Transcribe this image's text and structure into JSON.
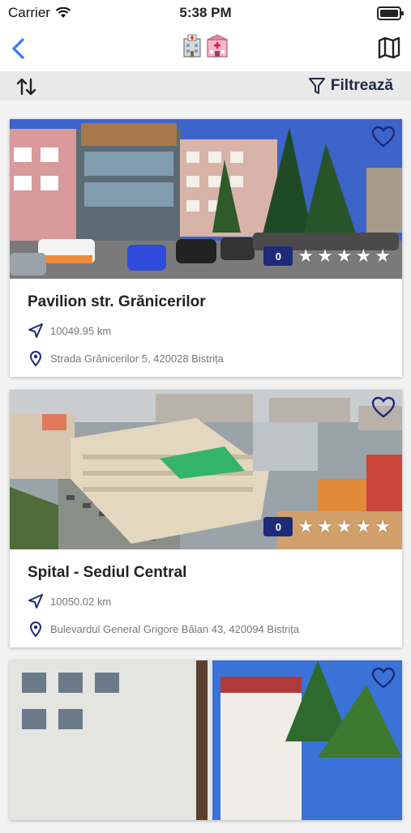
{
  "status": {
    "carrier": "Carrier",
    "time": "5:38 PM"
  },
  "toolbar": {
    "filter_label": "Filtrează"
  },
  "cards": [
    {
      "title": "Pavilion str. Grănicerilor",
      "distance": "10049.95 km",
      "address": "Strada Grănicerilor 5, 420028 Bistrița",
      "rating": "0"
    },
    {
      "title": "Spital - Sediul Central",
      "distance": "10050.02 km",
      "address": "Bulevardul General Grigore Bălan 43, 420094 Bistrița",
      "rating": "0"
    },
    {
      "title": "",
      "distance": "",
      "address": "",
      "rating": ""
    }
  ],
  "colors": {
    "accent": "#1e2a7a",
    "nav_blue": "#2f7cf6",
    "toolbar_bg": "#e9e9e9"
  },
  "icons": [
    "back-icon",
    "hospital-logo-icon",
    "map-icon",
    "sort-icon",
    "filter-icon",
    "heart-icon",
    "navigation-arrow-icon",
    "location-pin-icon",
    "star-icon"
  ]
}
